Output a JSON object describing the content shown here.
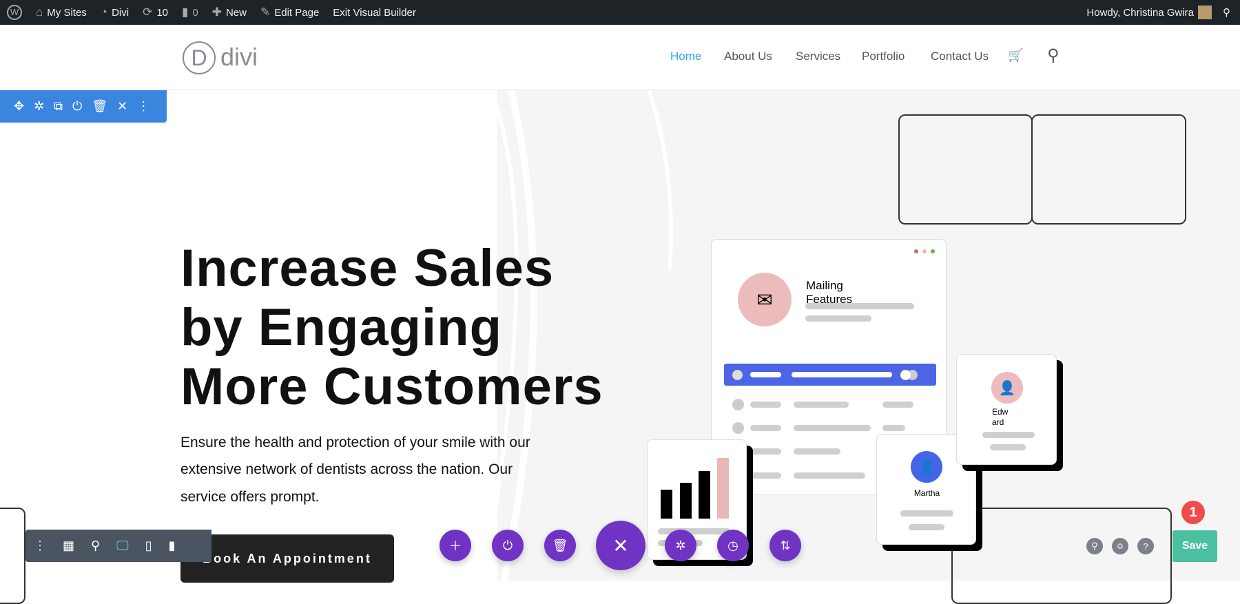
{
  "adminbar": {
    "my_sites": "My Sites",
    "site": "Divi",
    "updates": "10",
    "comments": "0",
    "new": "New",
    "edit_page": "Edit Page",
    "exit_builder": "Exit Visual Builder",
    "howdy": "Howdy, Christina Gwira"
  },
  "header": {
    "logo_letter": "D",
    "logo_text": "divi",
    "nav": [
      "Home",
      "About Us",
      "Services",
      "Portfolio",
      "Contact Us"
    ],
    "active_color": "#2ea3f2"
  },
  "hero": {
    "title_lines": [
      "Increase Sales",
      "by Engaging",
      "More Customers"
    ],
    "body_lines": [
      "Ensure the health and protection of your smile with our",
      "extensive network of dentists across the nation. Our",
      "service offers prompt."
    ],
    "cta": "Book An Appointment"
  },
  "illustration": {
    "card_title_1": "Mailing",
    "card_title_2": "Features",
    "person1_a": "Edw",
    "person1_b": "ard",
    "person2": "Martha"
  },
  "builder": {
    "save": "Save",
    "badge": "1",
    "accent": "#7133c4"
  }
}
